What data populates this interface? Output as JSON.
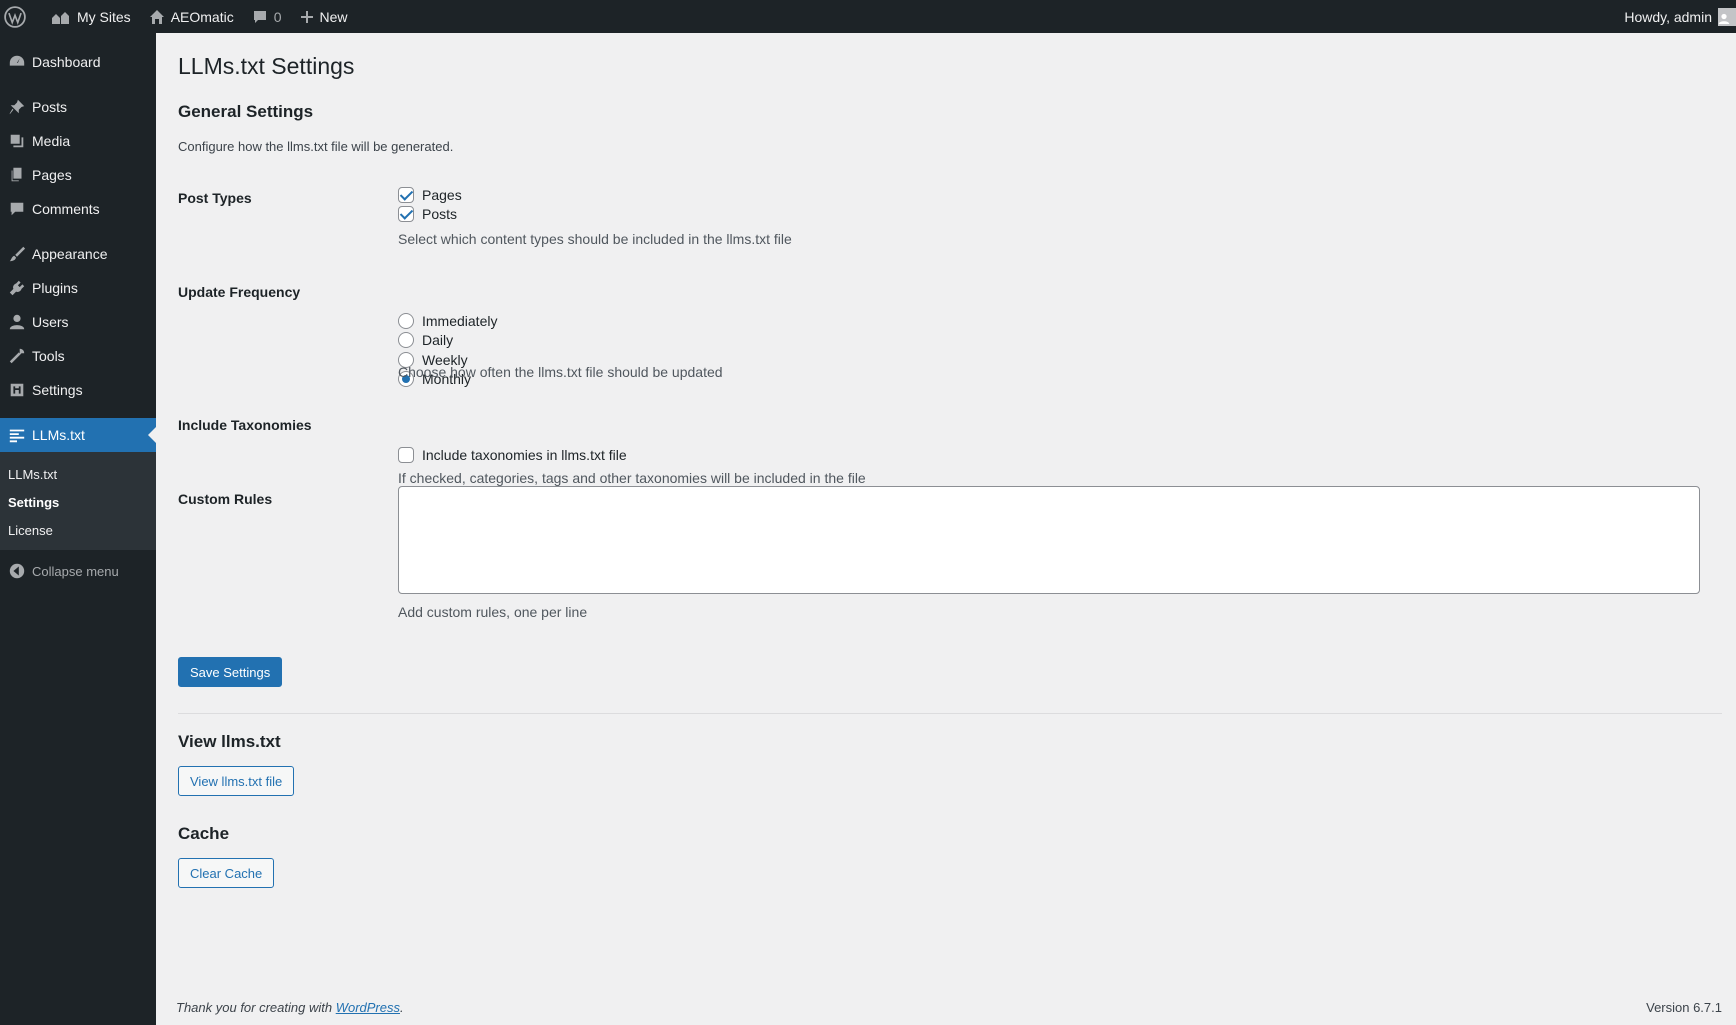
{
  "adminbar": {
    "my_sites": "My Sites",
    "site_name": "AEOmatic",
    "comments_count": "0",
    "new_label": "New",
    "howdy": "Howdy, admin"
  },
  "sidebar": {
    "dashboard": "Dashboard",
    "posts": "Posts",
    "media": "Media",
    "pages": "Pages",
    "comments": "Comments",
    "appearance": "Appearance",
    "plugins": "Plugins",
    "users": "Users",
    "tools": "Tools",
    "settings": "Settings",
    "llms": "LLMs.txt",
    "sub_llms": "LLMs.txt",
    "sub_settings": "Settings",
    "sub_license": "License",
    "collapse": "Collapse menu"
  },
  "page": {
    "title": "LLMs.txt Settings",
    "general_heading": "General Settings",
    "general_desc": "Configure how the llms.txt file will be generated.",
    "post_types_label": "Post Types",
    "post_type_pages": "Pages",
    "post_type_posts": "Posts",
    "post_types_help": "Select which content types should be included in the llms.txt file",
    "frequency_label": "Update Frequency",
    "freq_immediately": "Immediately",
    "freq_daily": "Daily",
    "freq_weekly": "Weekly",
    "freq_monthly": "Monthly",
    "frequency_help": "Choose how often the llms.txt file should be updated",
    "taxonomies_label": "Include Taxonomies",
    "taxonomies_option": "Include taxonomies in llms.txt file",
    "taxonomies_help": "If checked, categories, tags and other taxonomies will be included in the file",
    "custom_rules_label": "Custom Rules",
    "custom_rules_value": "",
    "custom_rules_help": "Add custom rules, one per line",
    "save_button": "Save Settings",
    "view_heading": "View llms.txt",
    "view_button": "View llms.txt file",
    "cache_heading": "Cache",
    "clear_cache_button": "Clear Cache"
  },
  "footer": {
    "thanks_prefix": "Thank you for creating with ",
    "wordpress_link": "WordPress",
    "thanks_suffix": ".",
    "version": "Version 6.7.1"
  },
  "colors": {
    "accent": "#2271b1",
    "admin_bar": "#1d2327",
    "background": "#f0f0f1"
  }
}
